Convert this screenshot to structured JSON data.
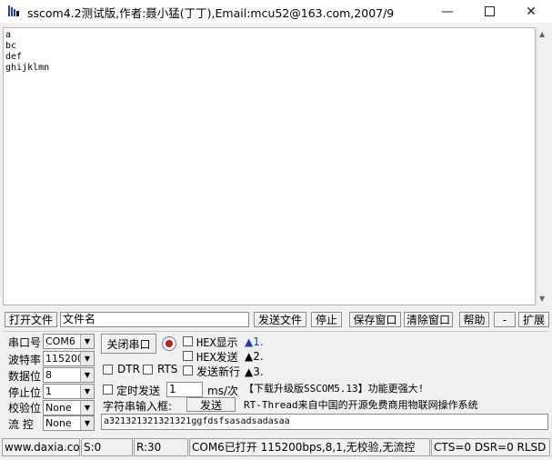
{
  "window": {
    "title": "sscom4.2测试版,作者:聂小猛(丁丁),Email:mcu52@163.com,2007/9"
  },
  "receive": {
    "lines": "a\nbc\ndef\nghijklmn"
  },
  "file_bar": {
    "open_file": "打开文件",
    "filename": "文件名",
    "send_file": "发送文件",
    "stop": "停止",
    "save_window": "保存窗口",
    "clear_window": "清除窗口",
    "help": "帮助",
    "minus": "-",
    "expand": "扩展"
  },
  "serial": {
    "port_label": "串口号",
    "port_value": "COM6",
    "baud_label": "波特率",
    "baud_value": "115200",
    "data_label": "数据位",
    "data_value": "8",
    "stop_label": "停止位",
    "stop_value": "1",
    "parity_label": "校验位",
    "parity_value": "None",
    "flow_label": "流 控",
    "flow_value": "None"
  },
  "controls": {
    "close_port": "关闭串口",
    "hex_display": "HEX显示",
    "hex_send": "HEX发送",
    "send_newline": "发送新行",
    "dtr": "DTR",
    "rts": "RTS",
    "timed_send": "定时发送",
    "interval_value": "1",
    "interval_unit": "ms/次",
    "input_label": "字符串输入框:",
    "send": "发送",
    "send_text": "a321321321321321ggfdsfsasadsadasaa"
  },
  "info": {
    "item1": "1.",
    "item2": "2.",
    "item3": "3.",
    "upgrade": "【下载升级版SSCOM5.13】功能更强大!",
    "rtthread": "RT-Thread来自中国的开源免费商用物联网操作系统"
  },
  "status": {
    "website": "www.daxia.cor",
    "sent": "S:0",
    "received": "R:30",
    "port_state": "COM6已打开  115200bps,8,1,无校验,无流控",
    "signals": "CTS=0 DSR=0 RLSD"
  },
  "colors": {
    "accent": "#1f3fbf",
    "led": "#c41e14",
    "recv_bg": "#ffffff",
    "window_bg": "#f0f0f0"
  }
}
